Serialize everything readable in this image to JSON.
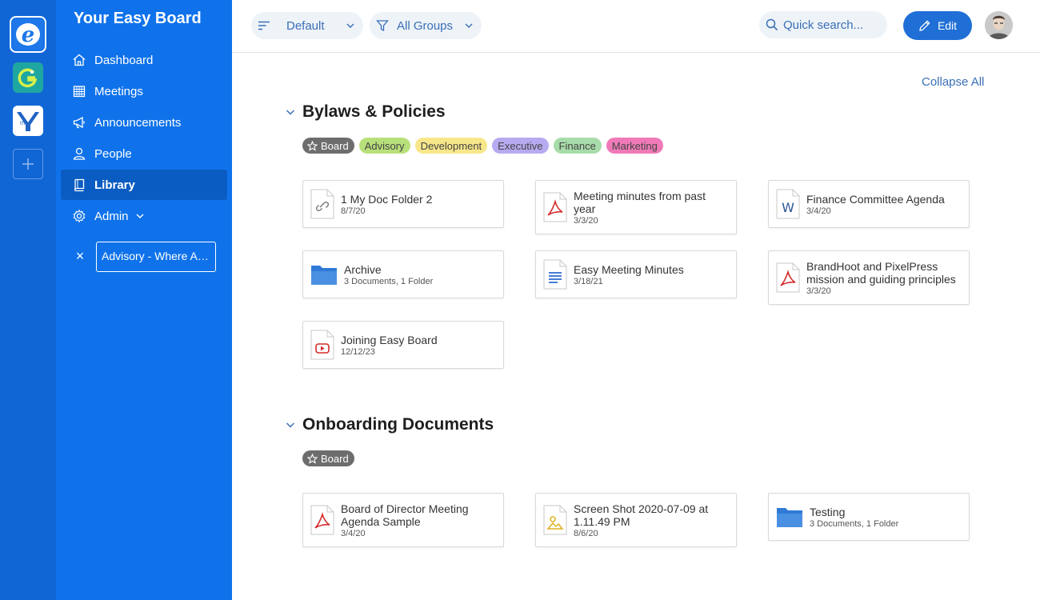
{
  "orgs": [
    {
      "name": "easy-board-org",
      "initial": "e",
      "active": true
    },
    {
      "name": "g-org",
      "initial": "G"
    },
    {
      "name": "ymca-org",
      "initial": "Y"
    }
  ],
  "sidebar": {
    "board_title": "Your Easy Board",
    "items": [
      {
        "label": "Dashboard",
        "icon": "home-icon"
      },
      {
        "label": "Meetings",
        "icon": "calendar-icon"
      },
      {
        "label": "Announcements",
        "icon": "megaphone-icon"
      },
      {
        "label": "People",
        "icon": "person-icon"
      },
      {
        "label": "Library",
        "icon": "book-icon",
        "active": true
      },
      {
        "label": "Admin",
        "icon": "gear-icon"
      }
    ],
    "pinned": {
      "label": "Advisory - Where Are We"
    }
  },
  "toolbar": {
    "sort_label": "Default",
    "group_label": "All Groups",
    "search_placeholder": "Quick search...",
    "edit_label": "Edit"
  },
  "main": {
    "collapse_all": "Collapse All",
    "sections": [
      {
        "title": "Bylaws & Policies",
        "tags": [
          {
            "label": "Board",
            "color": "#6d6d6d"
          },
          {
            "label": "Advisory",
            "color": "#b8e07a"
          },
          {
            "label": "Development",
            "color": "#f7e78a"
          },
          {
            "label": "Executive",
            "color": "#b8aaf0"
          },
          {
            "label": "Finance",
            "color": "#a8dcaa"
          },
          {
            "label": "Marketing",
            "color": "#f07ab8"
          }
        ],
        "items": [
          {
            "name": "1 My Doc Folder 2",
            "meta": "8/7/20",
            "type": "link"
          },
          {
            "name": "Meeting minutes from past year",
            "meta": "3/3/20",
            "type": "pdf"
          },
          {
            "name": "Finance Committee Agenda",
            "meta": "3/4/20",
            "type": "word"
          },
          {
            "name": "Archive",
            "meta": "3 Documents, 1 Folder",
            "type": "folder"
          },
          {
            "name": "Easy Meeting Minutes",
            "meta": "3/18/21",
            "type": "doc"
          },
          {
            "name": "BrandHoot and PixelPress mission and guiding principles",
            "meta": "3/3/20",
            "type": "pdf"
          },
          {
            "name": "Joining Easy Board",
            "meta": "12/12/23",
            "type": "video"
          }
        ]
      },
      {
        "title": "Onboarding Documents",
        "tags": [
          {
            "label": "Board",
            "color": "#6d6d6d"
          }
        ],
        "items": [
          {
            "name": "Board of Director Meeting Agenda Sample",
            "meta": "3/4/20",
            "type": "pdf"
          },
          {
            "name": "Screen Shot 2020-07-09 at 1.11.49 PM",
            "meta": "8/6/20",
            "type": "image"
          },
          {
            "name": "Testing",
            "meta": "3 Documents, 1 Folder",
            "type": "folder"
          }
        ]
      }
    ]
  },
  "colors": {
    "rail": "#1166d6",
    "sidebar": "#0f72ea",
    "sidebar_active": "#0b5cc2",
    "accent": "#1f6fd6",
    "link": "#3a6fb5",
    "pdf_red": "#d42a2a",
    "word_blue": "#2b5797",
    "folder_blue": "#2f7ad6"
  }
}
